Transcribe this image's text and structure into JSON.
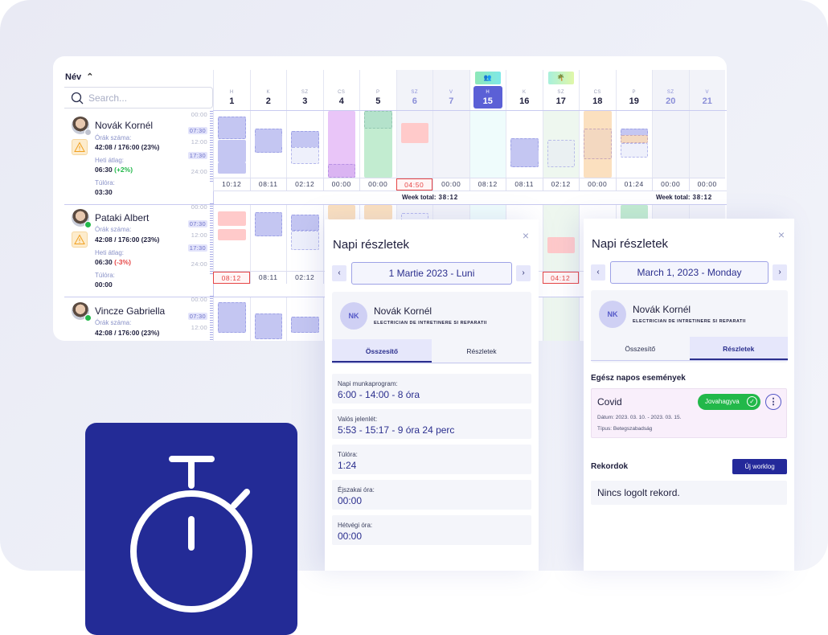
{
  "calendar": {
    "name_header": "Név",
    "search_placeholder": "Search...",
    "days": [
      {
        "letter": "H",
        "num": "1",
        "type": "workday"
      },
      {
        "letter": "K",
        "num": "2",
        "type": "workday"
      },
      {
        "letter": "SZ",
        "num": "3",
        "type": "workday"
      },
      {
        "letter": "CS",
        "num": "4",
        "type": "workday"
      },
      {
        "letter": "P",
        "num": "5",
        "type": "workday"
      },
      {
        "letter": "SZ",
        "num": "6",
        "type": "weekend"
      },
      {
        "letter": "V",
        "num": "7",
        "type": "weekend"
      },
      {
        "letter": "H",
        "num": "15",
        "type": "today",
        "badge": "team"
      },
      {
        "letter": "K",
        "num": "16",
        "type": "workday"
      },
      {
        "letter": "SZ",
        "num": "17",
        "type": "vacation",
        "badge": "vacation"
      },
      {
        "letter": "CS",
        "num": "18",
        "type": "workday"
      },
      {
        "letter": "P",
        "num": "19",
        "type": "workday"
      },
      {
        "letter": "SZ",
        "num": "20",
        "type": "weekend"
      },
      {
        "letter": "V",
        "num": "21",
        "type": "weekend"
      }
    ],
    "time_scale": {
      "labels": [
        "00:00",
        "07:30",
        "12:00",
        "17:30",
        "24:00"
      ],
      "highlighted": [
        "07:30",
        "17:30"
      ]
    },
    "employees": [
      {
        "name": "Novák Kornél",
        "status": "away",
        "hours_label": "Órák száma:",
        "hours_value": "42:08 / 176:00 (23%)",
        "avg_label": "Heti átlag:",
        "avg_value": "06:30",
        "avg_delta": "(+2%)",
        "avg_delta_sign": "positive",
        "overtime_label": "Túlóra:",
        "overtime_value": "03:30",
        "daily_totals": [
          "10:12",
          "08:11",
          "02:12",
          "00:00",
          "00:00",
          "04:50",
          "00:00",
          "08:12",
          "08:11",
          "02:12",
          "00:00",
          "01:24",
          "00:00",
          "00:00"
        ],
        "alert_days": [
          5
        ],
        "week_totals": [
          "Week total:",
          "38:12",
          "Week total:",
          "38:12"
        ]
      },
      {
        "name": "Pataki Albert",
        "status": "online",
        "hours_label": "Órák száma:",
        "hours_value": "42:08 / 176:00 (23%)",
        "avg_label": "Heti átlag:",
        "avg_value": "06:30",
        "avg_delta": "(-3%)",
        "avg_delta_sign": "negative",
        "overtime_label": "Túlóra:",
        "overtime_value": "00:00",
        "daily_totals": [
          "08:12",
          "08:11",
          "02:12",
          "",
          "",
          "",
          "",
          "",
          "",
          "04:12",
          "",
          "",
          "",
          ""
        ],
        "alert_days": [
          0,
          9
        ]
      },
      {
        "name": "Vincze Gabriella",
        "status": "online",
        "hours_label": "Órák száma:",
        "hours_value": "42:08 / 176:00 (23%)"
      }
    ],
    "week_total_label": "Week total:",
    "week_total_value": "38:12"
  },
  "panel_summary": {
    "title": "Napi részletek",
    "close_icon": "×",
    "prev": "‹",
    "next": "›",
    "date": "1 Martie 2023 - Luni",
    "initials": "NK",
    "employee": "Novák Kornél",
    "job": "ELECTRICIAN DE INTRETINERE SI REPARATII",
    "tabs": [
      "Összesítő",
      "Részletek"
    ],
    "active_tab": 0,
    "items": [
      {
        "label": "Napi munkaprogram:",
        "value": "6:00 - 14:00 - 8 óra"
      },
      {
        "label": "Valós jelenlét:",
        "value": "5:53 - 15:17 - 9 óra 24 perc"
      },
      {
        "label": "Túlóra:",
        "value": "1:24"
      },
      {
        "label": "Éjszakai óra:",
        "value": "00:00"
      },
      {
        "label": "Hétvégi óra:",
        "value": "00:00"
      }
    ]
  },
  "panel_details": {
    "title": "Napi részletek",
    "close_icon": "×",
    "prev": "‹",
    "next": "›",
    "date": "March 1, 2023 - Monday",
    "initials": "NK",
    "employee": "Novák Kornél",
    "job": "ELECTRICIAN DE INTRETINERE SI REPARATII",
    "tabs": [
      "Összesítő",
      "Részletek"
    ],
    "active_tab": 1,
    "events_title": "Egész napos események",
    "event": {
      "title": "Covid",
      "status": "Jovahagyva",
      "date": "Dátum: 2023. 03. 10. - 2023. 03. 15.",
      "type": "Típus: Betegszabadság"
    },
    "records_title": "Rekordok",
    "new_worklog": "Új worklog",
    "no_records": "Nincs logolt rekord."
  },
  "colors": {
    "brand": "#232b96",
    "accent": "#5b60d6",
    "approved": "#22b84a",
    "alert": "#e64545"
  },
  "icons": {
    "tile": "stopwatch-icon"
  }
}
